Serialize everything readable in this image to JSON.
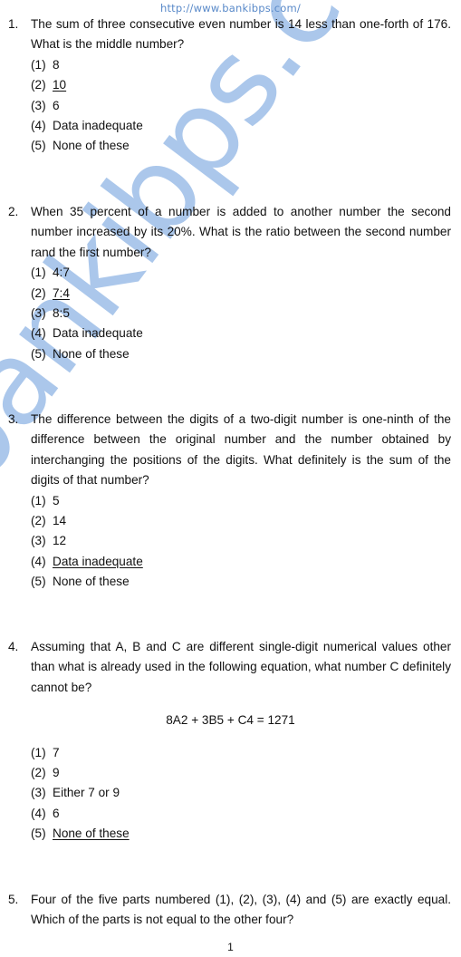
{
  "header": {
    "url": "http://www.bankibps.com/"
  },
  "watermark": {
    "text": "bankibps.com",
    "color": "#a7c5ea"
  },
  "questions": [
    {
      "number": "1.",
      "stem": "The sum of three consecutive even number is 14 less than one-forth of 176. What is the middle number?",
      "equation": null,
      "options": [
        {
          "num": "(1)",
          "text": "8",
          "underlined": false
        },
        {
          "num": "(2)",
          "text": "10",
          "underlined": true
        },
        {
          "num": "(3)",
          "text": "6",
          "underlined": false
        },
        {
          "num": "(4)",
          "text": "Data inadequate",
          "underlined": false
        },
        {
          "num": "(5)",
          "text": "None of these",
          "underlined": false
        }
      ]
    },
    {
      "number": "2.",
      "stem": "When 35 percent of a number is added to another number the second number increased by its 20%. What is the ratio between the second number rand the first number?",
      "equation": null,
      "options": [
        {
          "num": "(1)",
          "text": "4:7",
          "underlined": false
        },
        {
          "num": "(2)",
          "text": "7:4",
          "underlined": true
        },
        {
          "num": "(3)",
          "text": "8:5",
          "underlined": false
        },
        {
          "num": "(4)",
          "text": "Data inadequate",
          "underlined": false
        },
        {
          "num": "(5)",
          "text": "None of these",
          "underlined": false
        }
      ]
    },
    {
      "number": "3.",
      "stem": "The difference between the digits of a two-digit number is one-ninth of the difference between the original number and the number obtained by interchanging the positions of the digits. What definitely is the sum of the digits of that number?",
      "equation": null,
      "options": [
        {
          "num": "(1)",
          "text": "5",
          "underlined": false
        },
        {
          "num": "(2)",
          "text": "14",
          "underlined": false
        },
        {
          "num": "(3)",
          "text": "12",
          "underlined": false
        },
        {
          "num": "(4)",
          "text": "Data inadequate",
          "underlined": true
        },
        {
          "num": "(5)",
          "text": "None of these",
          "underlined": false
        }
      ]
    },
    {
      "number": "4.",
      "stem": "Assuming that A, B and C are different single-digit numerical values other than what is already used in the following equation, what number C definitely cannot be?",
      "equation": "8A2 + 3B5 + C4 = 1271",
      "options": [
        {
          "num": "(1)",
          "text": "7",
          "underlined": false
        },
        {
          "num": "(2)",
          "text": "9",
          "underlined": false
        },
        {
          "num": "(3)",
          "text": "Either 7 or 9",
          "underlined": false
        },
        {
          "num": "(4)",
          "text": "6",
          "underlined": false
        },
        {
          "num": "(5)",
          "text": "None of these",
          "underlined": true
        }
      ]
    },
    {
      "number": "5.",
      "stem": "Four of the five parts numbered (1), (2), (3), (4) and (5) are exactly equal. Which of the parts is not equal to the other four?",
      "equation": null,
      "options": []
    }
  ],
  "footer": {
    "page_number": "1"
  }
}
